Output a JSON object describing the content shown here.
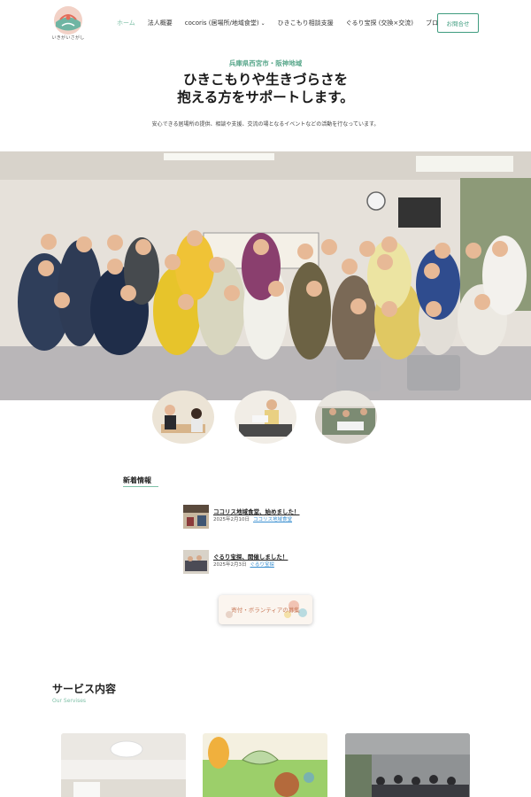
{
  "header": {
    "logo_text": "いきがいさがし",
    "nav": [
      {
        "label": "ホーム",
        "active": true
      },
      {
        "label": "法人概要"
      },
      {
        "label": "cocoris (居場所/地域食堂)",
        "has_dropdown": true
      },
      {
        "label": "ひきこもり相談支援"
      },
      {
        "label": "ぐるり宝探 (交換×交流)"
      },
      {
        "label": "ブログ"
      }
    ],
    "contact_label": "お問合せ"
  },
  "hero": {
    "region": "兵庫県西宮市・阪神地域",
    "title_line1": "ひきこもりや生きづらさを",
    "title_line2": "抱える方をサポートします。",
    "description": "安心できる居場所の提供、相談や支援、交流の場となるイベントなどの活動を行なっています。"
  },
  "news": {
    "heading": "新着情報",
    "items": [
      {
        "title": "ココリス地域食堂、始めました！",
        "date": "2025年2月10日",
        "category": "ココリス地域食堂"
      },
      {
        "title": "ぐるり宝探、開催しました！",
        "date": "2025年2月3日",
        "category": "ぐるり宝探"
      }
    ]
  },
  "banner": {
    "label": "寄付・ボランティアの募集"
  },
  "services": {
    "title": "サービス内容",
    "subtitle": "Our Servises"
  },
  "colors": {
    "accent": "#7ec0a7",
    "accent_dark": "#3f9c7f",
    "link": "#3a8fd0"
  }
}
